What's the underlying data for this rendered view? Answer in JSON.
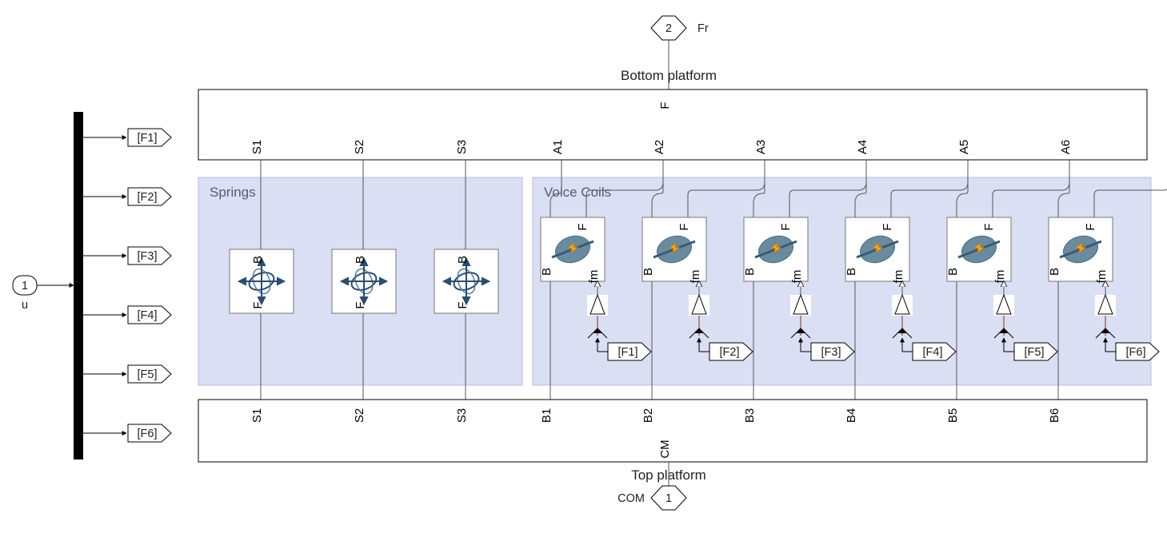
{
  "input_port": {
    "number": "1",
    "label": "u"
  },
  "demux_tags": [
    "[F1]",
    "[F2]",
    "[F3]",
    "[F4]",
    "[F5]",
    "[F6]"
  ],
  "top_port": {
    "number": "2",
    "label": "Fr"
  },
  "bottom_platform_label": "Bottom platform",
  "bottom_platform_port": "F",
  "bottom_platform_spring_ports": [
    "S1",
    "S2",
    "S3"
  ],
  "bottom_platform_coil_ports": [
    "A1",
    "A2",
    "A3",
    "A4",
    "A5",
    "A6"
  ],
  "springs_group_title": "Springs",
  "voice_coils_group_title": "Voice Coils",
  "spring_block_ports": {
    "top": "B",
    "bottom": "F"
  },
  "coil_block_ports": {
    "left": "B",
    "top": "F",
    "right": "fm"
  },
  "coil_force_tags": [
    "[F1]",
    "[F2]",
    "[F3]",
    "[F4]",
    "[F5]",
    "[F6]"
  ],
  "top_platform_label": "Top platform",
  "top_platform_spring_ports": [
    "S1",
    "S2",
    "S3"
  ],
  "top_platform_coil_ports": [
    "B1",
    "B2",
    "B3",
    "B4",
    "B5",
    "B6"
  ],
  "top_platform_cm": "CM",
  "com_port": {
    "number": "1",
    "label": "COM"
  }
}
